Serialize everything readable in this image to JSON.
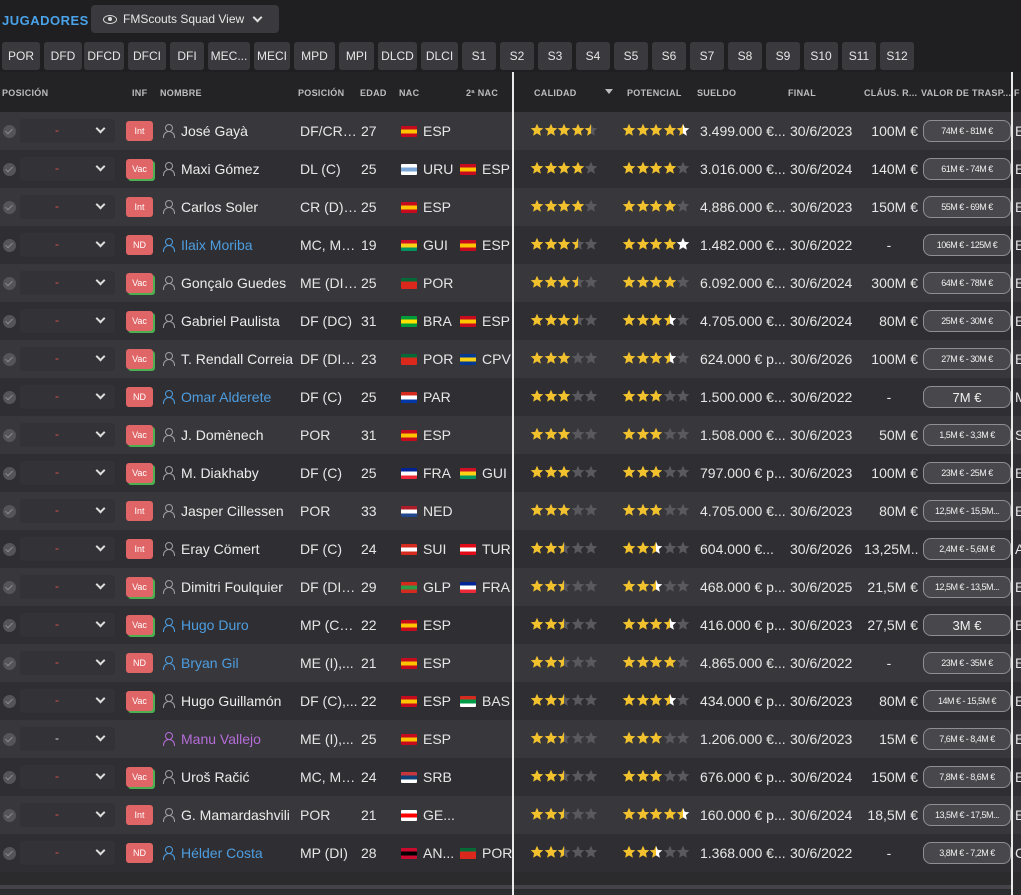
{
  "app": {
    "title": "JUGADORES",
    "view_name": "FMScouts Squad View"
  },
  "tabs": [
    "POR",
    "DFD",
    "DFCD",
    "DFCI",
    "DFI",
    "MEC...",
    "MECI",
    "MPD",
    "MPI",
    "DLCD",
    "DLCI",
    "S1",
    "S2",
    "S3",
    "S4",
    "S5",
    "S6",
    "S7",
    "S8",
    "S9",
    "S10",
    "S11",
    "S12"
  ],
  "columns": {
    "posicion_sel": "POSICIÓN",
    "inf": "INF",
    "nombre": "NOMBRE",
    "posicion": "POSICIÓN",
    "edad": "EDAD",
    "nac": "NAC",
    "nac2": "2ª NAC",
    "calidad": "CALIDAD",
    "potencial": "POTENCIAL",
    "sueldo": "SUELDO",
    "final": "FINAL",
    "clausula": "CLÁUS. R...",
    "valor": "VALOR DE TRASP...",
    "extra": "F"
  },
  "status_labels": {
    "int": "Int",
    "vac": "Vac",
    "nd": "ND"
  },
  "flags": {
    "ESP": [
      "#c60b1e",
      "#ffc400",
      "#c60b1e"
    ],
    "URU": [
      "#ffffff",
      "#7ba7d8",
      "#ffffff"
    ],
    "GUI": [
      "#ce1126",
      "#fcd116",
      "#009460"
    ],
    "POR": [
      "#046a38",
      "#da291c",
      "#da291c"
    ],
    "BRA": [
      "#009c3b",
      "#ffdf00",
      "#009c3b"
    ],
    "CPV": [
      "#003893",
      "#f7d116",
      "#003893"
    ],
    "PAR": [
      "#d52b1e",
      "#ffffff",
      "#0038a8"
    ],
    "FRA": [
      "#002395",
      "#ffffff",
      "#ed2939"
    ],
    "NED": [
      "#ae1c28",
      "#ffffff",
      "#21468b"
    ],
    "SUI": [
      "#d52b1e",
      "#ffffff",
      "#d52b1e"
    ],
    "TUR": [
      "#e30a17",
      "#ffffff",
      "#e30a17"
    ],
    "GLP": [
      "#d52b1e",
      "#2b9b45",
      "#d52b1e"
    ],
    "BAS": [
      "#d52b1e",
      "#009b48",
      "#ffffff"
    ],
    "SRB": [
      "#c6363c",
      "#0c4076",
      "#ffffff"
    ],
    "GE...": [
      "#ffffff",
      "#ff0000",
      "#ffffff"
    ],
    "AN...": [
      "#cc092f",
      "#000000",
      "#cc092f"
    ]
  },
  "players": [
    {
      "status": "Int",
      "pos_sel": "-",
      "name": "José Gayà",
      "name_style": "normal",
      "position": "DF/CR/...",
      "age": "27",
      "nat": "ESP",
      "nat2": "",
      "quality": 4.5,
      "potential": 4.5,
      "wage": "3.499.000 €...",
      "end": "30/6/2023",
      "clause": "100M €",
      "value": "74M € - 81M €"
    },
    {
      "status": "Vac",
      "pos_sel": "-",
      "name": "Maxi Gómez",
      "name_style": "normal",
      "position": "DL (C)",
      "age": "25",
      "nat": "URU",
      "nat2": "ESP",
      "quality": 4,
      "potential": 4,
      "wage": "3.016.000 €...",
      "end": "30/6/2024",
      "clause": "140M €",
      "value": "61M € - 74M €"
    },
    {
      "status": "Int",
      "pos_sel": "-",
      "name": "Carlos Soler",
      "name_style": "normal",
      "position": "CR (D),...",
      "age": "25",
      "nat": "ESP",
      "nat2": "",
      "quality": 4,
      "potential": 4,
      "wage": "4.886.000 €...",
      "end": "30/6/2023",
      "clause": "150M €",
      "value": "55M € - 69M €"
    },
    {
      "status": "ND",
      "pos_sel": "-",
      "name": "Ilaix Moriba",
      "name_style": "blue",
      "position": "MC, ME...",
      "age": "19",
      "nat": "GUI",
      "nat2": "ESP",
      "quality": 3.5,
      "potential": 5,
      "wage": "1.482.000 €...",
      "end": "30/6/2022",
      "clause": "-",
      "value": "106M € - 125M €"
    },
    {
      "status": "Vac",
      "pos_sel": "-",
      "name": "Gonçalo Guedes",
      "name_style": "normal",
      "position": "ME (DI),...",
      "age": "25",
      "nat": "POR",
      "nat2": "",
      "quality": 3.5,
      "potential": 4,
      "wage": "6.092.000 €...",
      "end": "30/6/2024",
      "clause": "300M €",
      "value": "64M € - 78M €"
    },
    {
      "status": "Vac",
      "pos_sel": "-",
      "name": "Gabriel Paulista",
      "name_style": "normal",
      "position": "DF (DC)",
      "age": "31",
      "nat": "BRA",
      "nat2": "ESP",
      "quality": 3.5,
      "potential": 3.5,
      "wage": "4.705.000 €...",
      "end": "30/6/2024",
      "clause": "80M €",
      "value": "25M € - 30M €"
    },
    {
      "status": "Vac",
      "pos_sel": "-",
      "name": "T. Rendall Correia",
      "name_style": "normal",
      "position": "DF (DI),...",
      "age": "23",
      "nat": "POR",
      "nat2": "CPV",
      "quality": 3,
      "potential": 3.5,
      "wage": "624.000 € p...",
      "end": "30/6/2026",
      "clause": "100M €",
      "value": "27M € - 30M €"
    },
    {
      "status": "ND",
      "pos_sel": "-",
      "name": "Omar Alderete",
      "name_style": "blue",
      "position": "DF (C)",
      "age": "25",
      "nat": "PAR",
      "nat2": "",
      "quality": 3,
      "potential": 3,
      "wage": "1.500.000 €...",
      "end": "30/6/2022",
      "clause": "-",
      "value": "7M €"
    },
    {
      "status": "Vac",
      "pos_sel": "-",
      "name": "J. Domènech",
      "name_style": "normal",
      "position": "POR",
      "age": "31",
      "nat": "ESP",
      "nat2": "",
      "quality": 3,
      "potential": 3,
      "wage": "1.508.000 €...",
      "end": "30/6/2023",
      "clause": "50M €",
      "value": "1,5M € - 3,3M €"
    },
    {
      "status": "Vac",
      "pos_sel": "-",
      "name": "M. Diakhaby",
      "name_style": "normal",
      "position": "DF (C)",
      "age": "25",
      "nat": "FRA",
      "nat2": "GUI",
      "quality": 3,
      "potential": 3,
      "wage": "797.000 € p...",
      "end": "30/6/2023",
      "clause": "100M €",
      "value": "23M € - 25M €"
    },
    {
      "status": "Int",
      "pos_sel": "-",
      "name": "Jasper Cillessen",
      "name_style": "normal",
      "position": "POR",
      "age": "33",
      "nat": "NED",
      "nat2": "",
      "quality": 3,
      "potential": 3,
      "wage": "4.705.000 €...",
      "end": "30/6/2023",
      "clause": "80M €",
      "value": "12,5M € - 15,5M..."
    },
    {
      "status": "Int",
      "pos_sel": "-",
      "name": "Eray Cömert",
      "name_style": "normal",
      "position": "DF (C)",
      "age": "24",
      "nat": "SUI",
      "nat2": "TUR",
      "quality": 2.5,
      "potential": 2.5,
      "wage": "604.000 €...",
      "end": "30/6/2026",
      "clause": "13,25M...",
      "value": "2,4M € - 5,6M €"
    },
    {
      "status": "Vac",
      "pos_sel": "-",
      "name": "Dimitri Foulquier",
      "name_style": "normal",
      "position": "DF (DI),...",
      "age": "29",
      "nat": "GLP",
      "nat2": "FRA",
      "quality": 2.5,
      "potential": 2.5,
      "wage": "468.000 € p...",
      "end": "30/6/2025",
      "clause": "21,5M €",
      "value": "12,5M € - 13,5M..."
    },
    {
      "status": "Vac",
      "pos_sel": "-",
      "name": "Hugo Duro",
      "name_style": "blue",
      "position": "MP (C),...",
      "age": "22",
      "nat": "ESP",
      "nat2": "",
      "quality": 2.5,
      "potential": 3.5,
      "wage": "416.000 € p...",
      "end": "30/6/2023",
      "clause": "27,5M €",
      "value": "3M €"
    },
    {
      "status": "ND",
      "pos_sel": "-",
      "name": "Bryan Gil",
      "name_style": "blue",
      "position": "ME (I),...",
      "age": "21",
      "nat": "ESP",
      "nat2": "",
      "quality": 2.5,
      "potential": 4,
      "wage": "4.865.000 €...",
      "end": "30/6/2022",
      "clause": "-",
      "value": "23M € - 35M €"
    },
    {
      "status": "Vac",
      "pos_sel": "-",
      "name": "Hugo Guillamón",
      "name_style": "normal",
      "position": "DF (C),...",
      "age": "22",
      "nat": "ESP",
      "nat2": "BAS",
      "quality": 2.5,
      "potential": 3.5,
      "wage": "434.000 € p...",
      "end": "30/6/2023",
      "clause": "80M €",
      "value": "14M € - 15,5M €"
    },
    {
      "status": "",
      "pos_sel": "-",
      "name": "Manu Vallejo",
      "name_style": "purple",
      "position": "ME (I),...",
      "age": "25",
      "nat": "ESP",
      "nat2": "",
      "quality": 2.5,
      "potential": 3,
      "wage": "1.206.000 €...",
      "end": "30/6/2023",
      "clause": "15M €",
      "value": "7,6M € - 8,4M €"
    },
    {
      "status": "Vac",
      "pos_sel": "-",
      "name": "Uroš Račić",
      "name_style": "normal",
      "position": "MC, ME...",
      "age": "24",
      "nat": "SRB",
      "nat2": "",
      "quality": 2.5,
      "potential": 3,
      "wage": "676.000 € p...",
      "end": "30/6/2024",
      "clause": "150M €",
      "value": "7,8M € - 8,6M €"
    },
    {
      "status": "Int",
      "pos_sel": "-",
      "name": "G. Mamardashvili",
      "name_style": "normal",
      "position": "POR",
      "age": "21",
      "nat": "GE...",
      "nat2": "",
      "quality": 2.5,
      "potential": 4.5,
      "wage": "160.000 € p...",
      "end": "30/6/2024",
      "clause": "18,5M €",
      "value": "13,5M € - 17,5M..."
    },
    {
      "status": "ND",
      "pos_sel": "-",
      "name": "Hélder Costa",
      "name_style": "blue",
      "position": "MP (DI)",
      "age": "28",
      "nat": "AN...",
      "nat2": "POR",
      "quality": 2.5,
      "potential": 2.5,
      "wage": "1.368.000 €...",
      "end": "30/6/2022",
      "clause": "-",
      "value": "3,8M € - 7,2M €"
    }
  ],
  "overflow_chars": [
    "E",
    "E",
    "E",
    "E",
    "E",
    "E",
    "E",
    "M",
    "S",
    "E",
    "E",
    "A",
    "E",
    "E",
    "E",
    "E",
    "E",
    "E",
    "E",
    "C"
  ],
  "colors": {
    "accent_blue": "#4aa3e8",
    "link_blue": "#4d9de0",
    "purple": "#b56cd8",
    "status_red": "#e06566",
    "star_gold": "#f2c12e",
    "star_white": "#ffffff",
    "star_empty": "#5a5a5e"
  }
}
